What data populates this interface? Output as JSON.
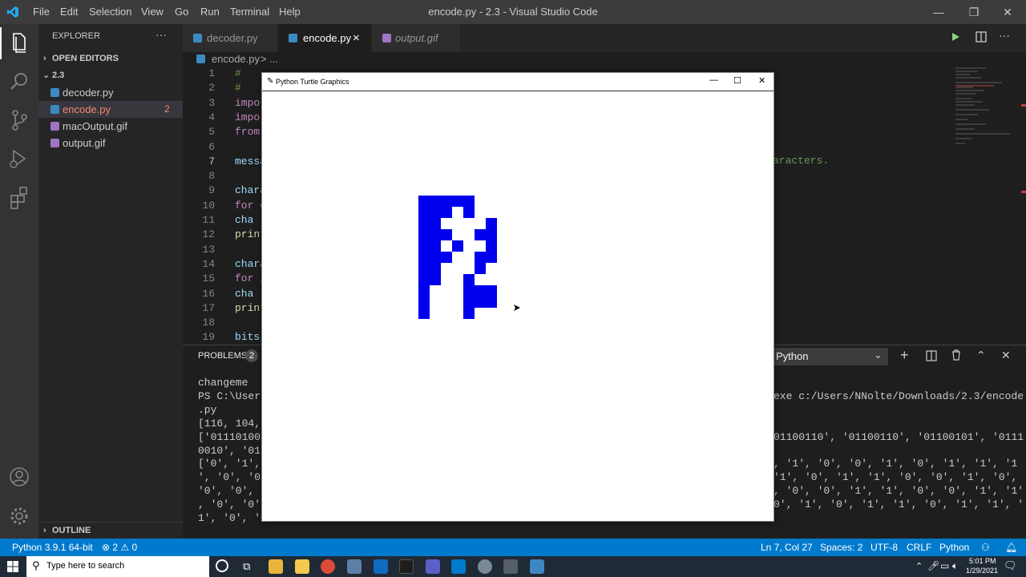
{
  "window": {
    "title": "encode.py - 2.3 - Visual Studio Code",
    "menu": [
      "File",
      "Edit",
      "Selection",
      "View",
      "Go",
      "Run",
      "Terminal",
      "Help"
    ]
  },
  "sidebar": {
    "header": "EXPLORER",
    "more": "···",
    "open_editors": "OPEN EDITORS",
    "folder": "2.3",
    "files": [
      {
        "name": "decoder.py",
        "type": "python"
      },
      {
        "name": "encode.py",
        "type": "python",
        "errors": "2"
      },
      {
        "name": "macOutput.gif",
        "type": "image"
      },
      {
        "name": "output.gif",
        "type": "image"
      }
    ],
    "outline": "OUTLINE"
  },
  "tabs": [
    {
      "label": "decoder.py"
    },
    {
      "label": "encode.py",
      "close": "×"
    },
    {
      "label": "output.gif"
    }
  ],
  "breadcrumb": {
    "file": "encode.py",
    "sep": ">",
    "rest": "..."
  },
  "editor": {
    "lines": [
      {
        "n": "1",
        "text": "#"
      },
      {
        "n": "2",
        "text": "#"
      },
      {
        "n": "3",
        "text": "impo"
      },
      {
        "n": "4",
        "text": "impo"
      },
      {
        "n": "5",
        "text": "from"
      },
      {
        "n": "6",
        "text": ""
      },
      {
        "n": "7",
        "text": "messa"
      },
      {
        "n": "8",
        "text": ""
      },
      {
        "n": "9",
        "text": "chara"
      },
      {
        "n": "10",
        "text": "for c"
      },
      {
        "n": "11",
        "text": "  cha"
      },
      {
        "n": "12",
        "text": "print"
      },
      {
        "n": "13",
        "text": ""
      },
      {
        "n": "14",
        "text": "chara"
      },
      {
        "n": "15",
        "text": "for i"
      },
      {
        "n": "16",
        "text": "  cha"
      },
      {
        "n": "17",
        "text": "print"
      },
      {
        "n": "18",
        "text": ""
      },
      {
        "n": "19",
        "text": "bits"
      }
    ],
    "line7_tail": "aracters."
  },
  "panel": {
    "problems_label": "PROBLEMS",
    "problems_count": "2",
    "terminal_select": "Python",
    "left_lines": [
      "changeme",
      "PS C:\\Users",
      ".py",
      "[116, 104,",
      "['01110100'",
      "0010', '011",
      "['0', '1',",
      "', '0', '0'",
      "'0', '0', '",
      ", '0', '0',",
      "1', '0', '0"
    ],
    "right_lines": [
      "",
      "exe c:/Users/NNolte/Downloads/2.3/encode",
      "",
      "",
      "01100110', '01100110', '01100101', '0111",
      "",
      ", '1', '0', '0', '1', '0', '1', '1', '1",
      "'1', '0', '1', '1', '0', '0', '1', '0',",
      ", '0', '0', '1', '1', '0', '0', '1', '1'",
      "0', '1', '0', '1', '1', '0', '1', '1', '",
      ""
    ]
  },
  "turtle": {
    "title": "Python Turtle Graphics"
  },
  "statusbar": {
    "interpreter": "Python 3.9.1 64-bit",
    "errors": "2",
    "warnings": "0",
    "position": "Ln 7, Col 27",
    "spaces": "Spaces: 2",
    "encoding": "UTF-8",
    "eol": "CRLF",
    "language": "Python"
  },
  "taskbar": {
    "search_placeholder": "Type here to search",
    "time": "5:01 PM",
    "date": "1/29/2021"
  },
  "colors": {
    "accent": "#007acc",
    "pixel": "#0000ee",
    "error": "#f48771"
  }
}
